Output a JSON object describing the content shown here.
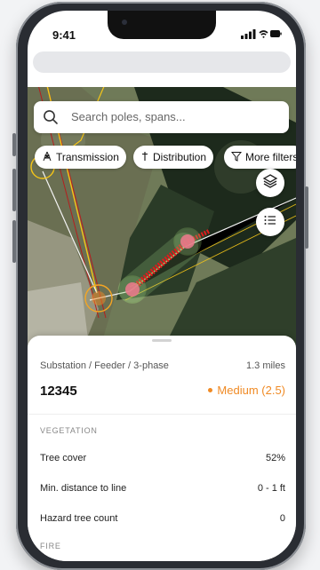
{
  "status_bar": {
    "time": "9:41"
  },
  "search": {
    "placeholder": "Search poles, spans..."
  },
  "filters": [
    {
      "label": "Transmission",
      "icon": "tower-icon"
    },
    {
      "label": "Distribution",
      "icon": "pole-icon"
    },
    {
      "label": "More filters",
      "icon": "filter-icon"
    }
  ],
  "map_controls": {
    "layers": "layers-icon",
    "list": "list-icon"
  },
  "details": {
    "breadcrumb": "Substation / Feeder / 3-phase",
    "distance": "1.3 miles",
    "id": "12345",
    "risk": "Medium (2.5)",
    "risk_color": "#f08a24",
    "section": "VEGETATION",
    "rows": [
      {
        "label": "Tree cover",
        "value": "52%"
      },
      {
        "label": "Min. distance to line",
        "value": "0 - 1 ft"
      },
      {
        "label": "Hazard tree count",
        "value": "0"
      }
    ],
    "next_section": "FIRE"
  }
}
